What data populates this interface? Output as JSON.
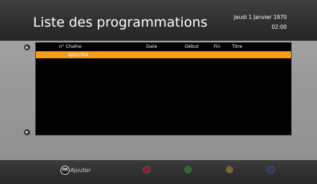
{
  "header": {
    "title": "Liste des programmations",
    "date": "Jeudi 1 Janvier 1970",
    "time": "02:00"
  },
  "list": {
    "columns": {
      "channel": "n° Chaîne",
      "date": "Date",
      "start": "Début",
      "end": "Fin",
      "title": "Titre"
    },
    "rows": [
      {
        "channel": "AJOUTER",
        "date": "...",
        "start": "...",
        "end": "...",
        "title": "..."
      }
    ]
  },
  "footer": {
    "ok_icon": "OK",
    "ok_label": "Ajouter",
    "colors": {
      "red": "#8e1c2b",
      "green": "#2d6b2d",
      "yellow": "#806a1f",
      "blue": "#253a70"
    }
  }
}
